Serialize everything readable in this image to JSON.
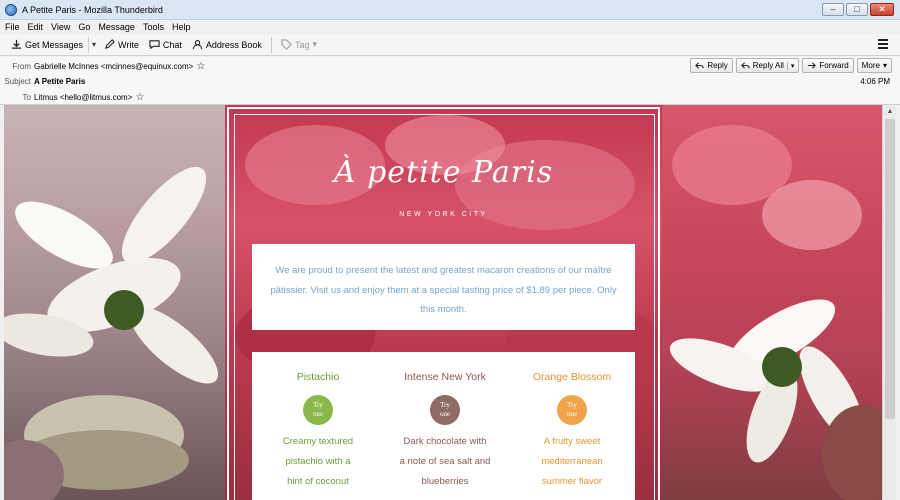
{
  "window": {
    "title": "A Petite Paris - Mozilla Thunderbird",
    "btn_minimize": "–",
    "btn_maximize": "□",
    "btn_close": "✕"
  },
  "menubar": {
    "items": [
      "File",
      "Edit",
      "View",
      "Go",
      "Message",
      "Tools",
      "Help"
    ]
  },
  "toolbar": {
    "get_messages": "Get Messages",
    "dropdown_arrow": "▾",
    "write": "Write",
    "chat": "Chat",
    "address_book": "Address Book",
    "tag": "Tag"
  },
  "header": {
    "from_label": "From",
    "from_value": "Gabrielle McInnes <mcinnes@equinux.com>",
    "subject_label": "Subject",
    "subject_value": "A Petite Paris",
    "to_label": "To",
    "to_value": "Litmus <hello@litmus.com>",
    "star": "☆",
    "time": "4:06 PM",
    "reply": "Reply",
    "reply_all": "Reply All",
    "forward": "Forward",
    "more": "More",
    "dropdown": "▾"
  },
  "email": {
    "logo": "À petite Paris",
    "city": "NEW YORK CITY",
    "intro": "We are proud to present the latest and greatest macaron creations of our maître pâtissier. Visit us and enjoy them at a special tasting price of $1.89 per piece. Only this month.",
    "products": [
      {
        "name": "Pistachio",
        "try_1": "Try",
        "try_2": "one",
        "desc_1": "Creamy textured",
        "desc_2": "pistachio with a",
        "desc_3": "hint of coconut",
        "color": "#8ab84a",
        "text_color": "#6f9e33"
      },
      {
        "name": "Intense New York",
        "try_1": "Try",
        "try_2": "one",
        "desc_1": "Dark chocolate with",
        "desc_2": "a note of sea salt and",
        "desc_3": "blueberries",
        "color": "#8e6b63",
        "text_color": "#8a5a55"
      },
      {
        "name": "Orange Blossom",
        "try_1": "Try",
        "try_2": "one",
        "desc_1": "A fruity sweet",
        "desc_2": "mediterranean",
        "desc_3": "summer flavor",
        "color": "#f0a44a",
        "text_color": "#e8952f"
      }
    ]
  },
  "colors": {
    "intro_text": "#7aa5cc",
    "titlebar": "#dbe6f3"
  }
}
